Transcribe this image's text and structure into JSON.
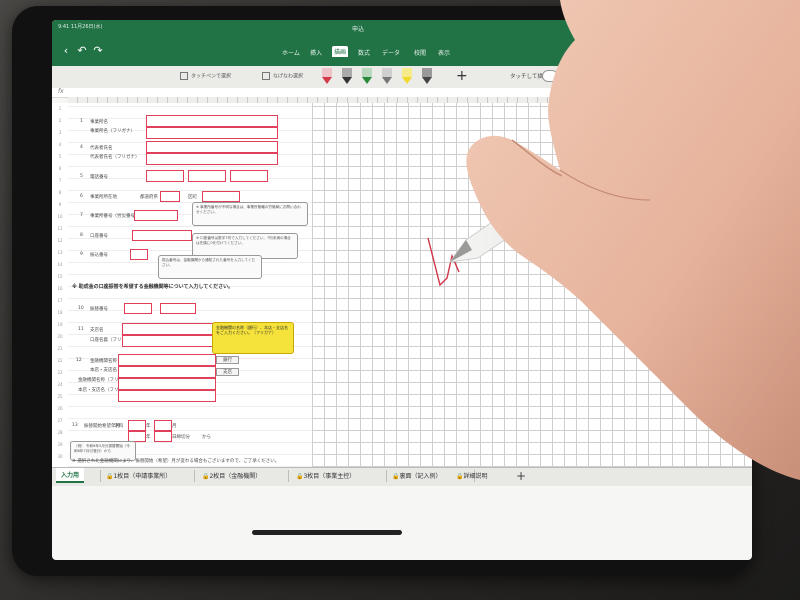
{
  "status": {
    "time": "9:41 11月26日(水)"
  },
  "window": {
    "file_name": "申込"
  },
  "ribbon": {
    "tabs": [
      "ホーム",
      "挿入",
      "描画",
      "数式",
      "データ",
      "校閲",
      "表示"
    ],
    "active_tab": "描画"
  },
  "pen_toolbar": {
    "option1": "タッチペンで選択",
    "option2": "なげなわ選択",
    "touch_draw_label": "タッチして描画する",
    "pens": [
      {
        "name": "pen-red",
        "color": "#d23a4a"
      },
      {
        "name": "pen-black",
        "color": "#333333"
      },
      {
        "name": "pen-green",
        "color": "#2a8a3a"
      },
      {
        "name": "pen-gray",
        "color": "#777777"
      },
      {
        "name": "highlighter-yellow",
        "color": "#f2d92b"
      },
      {
        "name": "pen-dark",
        "color": "#444444"
      }
    ]
  },
  "formula_bar": {
    "fx": "fx"
  },
  "form": {
    "s1": {
      "num": "1",
      "label": "事業所名",
      "sub": "事業所名（フリガナ）"
    },
    "s2": {
      "num": "4",
      "label": "代表者氏名",
      "sub": "代表者氏名（フリガナ）"
    },
    "s3": {
      "num": "5",
      "label": "電話番号"
    },
    "s4": {
      "num": "6",
      "label": "事業所所在地",
      "mid1": "都道府県",
      "mid2": "区町"
    },
    "s5": {
      "num": "7",
      "label": "事業所番号（労災番号）"
    },
    "s6": {
      "num": "8",
      "label": "口座番号"
    },
    "s7": {
      "num": "9",
      "label": "振込番号"
    },
    "section_header": "※ 助成金の口座振替を希望する金融機関等について入力してください。",
    "s10": {
      "num": "10",
      "label": "振替番号"
    },
    "s11": {
      "num": "11",
      "label": "支店名",
      "sub": "口座名義（フリガナ）"
    },
    "s12": {
      "num": "12",
      "label": "金融機関名称",
      "sub1": "本店・支店名",
      "sub2": "金融機関名称（フリガナ）",
      "sub3": "本店・支店名（フリガナ）",
      "tag1": "銀行",
      "tag2": "支店"
    },
    "s13": {
      "num": "13",
      "label": "振替開始希望年月",
      "era": "令和",
      "year": "年",
      "month": "月",
      "from": "から",
      "day_note": "日締切分"
    },
    "note1": "※ 事業所番号が不明な場合は、事業所管轄の労働局にお問い合わせください。",
    "note2": "※ 口座番号は数字7桁で入力してください。7桁未満の場合は先頭に0を付けてください。",
    "note3": "振込番号は、金融機関から通知された番号を入力してください。",
    "note4": "（例） 令和6年5月分振替開始（令和6年7月引落分）から",
    "yellow_note": "金融機関の名称（銀行）、本店・支店名をご入力ください。（フリガナ）",
    "footer_note": "※ 選択された金融機関により、振替開始（希望）月が変わる場合もございますので、ご了承ください。"
  },
  "sheet_tabs": [
    "入力用",
    "1枚目（申請事業所）",
    "2枚目（金融機関）",
    "3枚目（事業主控）",
    "裏面（記入例）",
    "詳細説明"
  ],
  "active_sheet": "入力用",
  "colors": {
    "excel_green": "#217346",
    "form_border": "#e0405a",
    "ink": "#d2354a"
  }
}
